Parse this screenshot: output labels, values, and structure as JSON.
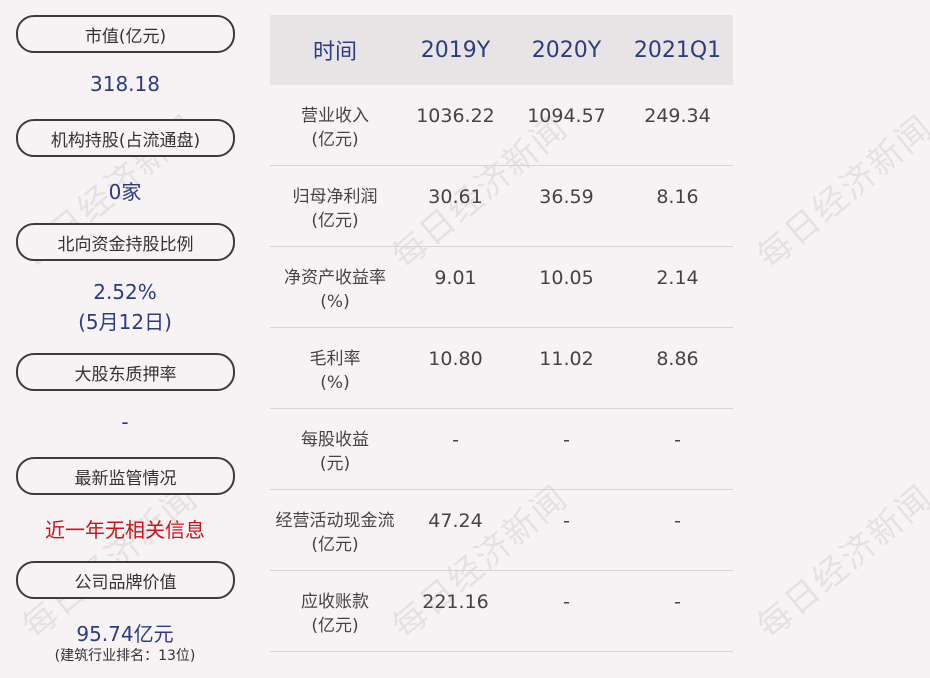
{
  "left": {
    "items": [
      {
        "label": "市值(亿元)",
        "value": "318.18"
      },
      {
        "label": "机构持股(占流通盘)",
        "value": "0家"
      },
      {
        "label": "北向资金持股比例",
        "value": "2.52%",
        "value2": "(5月12日)"
      },
      {
        "label": "大股东质押率",
        "value": "-"
      },
      {
        "label": "最新监管情况",
        "value": "近一年无相关信息"
      },
      {
        "label": "公司品牌价值",
        "value": "95.74亿元",
        "note": "(建筑行业排名：13位)"
      }
    ]
  },
  "table": {
    "headers": [
      "时间",
      "2019Y",
      "2020Y",
      "2021Q1"
    ],
    "rows": [
      {
        "label1": "营业收入",
        "label2": "(亿元)",
        "values": [
          "1036.22",
          "1094.57",
          "249.34"
        ]
      },
      {
        "label1": "归母净利润",
        "label2": "(亿元)",
        "values": [
          "30.61",
          "36.59",
          "8.16"
        ]
      },
      {
        "label1": "净资产收益率",
        "label2": "(%)",
        "values": [
          "9.01",
          "10.05",
          "2.14"
        ]
      },
      {
        "label1": "毛利率",
        "label2": "(%)",
        "values": [
          "10.80",
          "11.02",
          "8.86"
        ]
      },
      {
        "label1": "每股收益",
        "label2": "(元)",
        "values": [
          "-",
          "-",
          "-"
        ]
      },
      {
        "label1": "经营活动现金流",
        "label2": "(亿元)",
        "values": [
          "47.24",
          "-",
          "-"
        ]
      },
      {
        "label1": "应收账款",
        "label2": "(亿元)",
        "values": [
          "221.16",
          "-",
          "-"
        ]
      }
    ]
  },
  "watermark": "每日经济新闻"
}
